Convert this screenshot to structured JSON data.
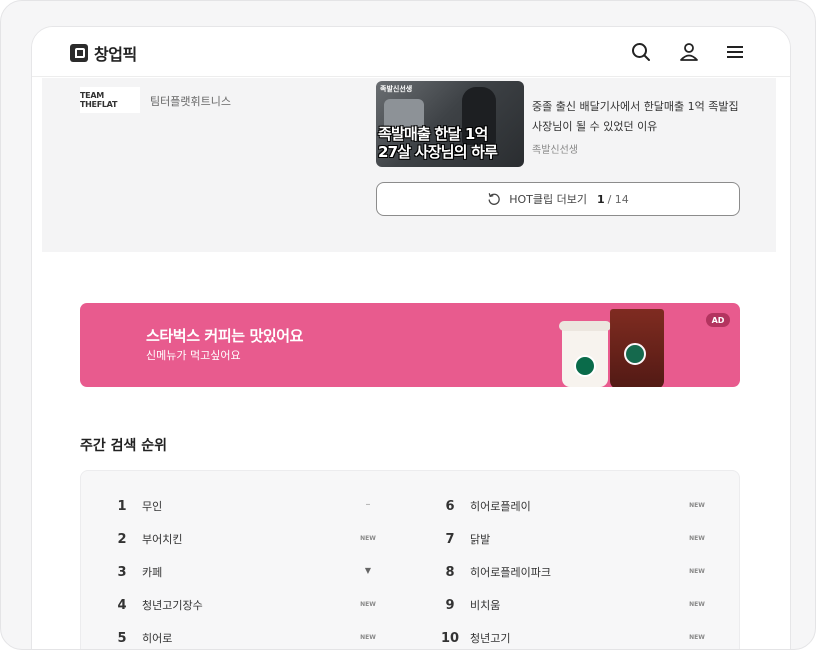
{
  "header": {
    "logo_text": "창업픽",
    "icons": [
      "search-icon",
      "user-icon",
      "menu-icon"
    ]
  },
  "brand": {
    "logo_text": "TEAM THEFLAT",
    "name": "팀터플랫휘트니스"
  },
  "hot_clip": {
    "thumb_caption_line1": "족발매출 한달 1억",
    "thumb_caption_line2": "27살 사장님의 하루",
    "thumb_tag": "족발신선생",
    "title": "중졸 출신 배달기사에서 한달매출 1억 족발집 사장님이 될 수 있었던 이유",
    "author": "족발신선생",
    "more_label": "HOT클립 더보기",
    "current_page": "1",
    "total_pages": "/ 14"
  },
  "ad": {
    "title": "스타벅스 커피는 맛있어요",
    "subtitle": "신메뉴가 먹고싶어요",
    "badge": "AD"
  },
  "ranking": {
    "heading": "주간 검색 순위",
    "left": [
      {
        "rank": "1",
        "keyword": "무인",
        "status": "–"
      },
      {
        "rank": "2",
        "keyword": "부어치킨",
        "status": "NEW"
      },
      {
        "rank": "3",
        "keyword": "카페",
        "status": "▼"
      },
      {
        "rank": "4",
        "keyword": "청년고기장수",
        "status": "NEW"
      },
      {
        "rank": "5",
        "keyword": "히어로",
        "status": "NEW"
      }
    ],
    "right": [
      {
        "rank": "6",
        "keyword": "히어로플레이",
        "status": "NEW"
      },
      {
        "rank": "7",
        "keyword": "닭발",
        "status": "NEW"
      },
      {
        "rank": "8",
        "keyword": "히어로플레이파크",
        "status": "NEW"
      },
      {
        "rank": "9",
        "keyword": "비치움",
        "status": "NEW"
      },
      {
        "rank": "10",
        "keyword": "청년고기",
        "status": "NEW"
      }
    ]
  },
  "colors": {
    "ad_background": "#e85b8e",
    "gray_section": "#f4f4f5"
  }
}
